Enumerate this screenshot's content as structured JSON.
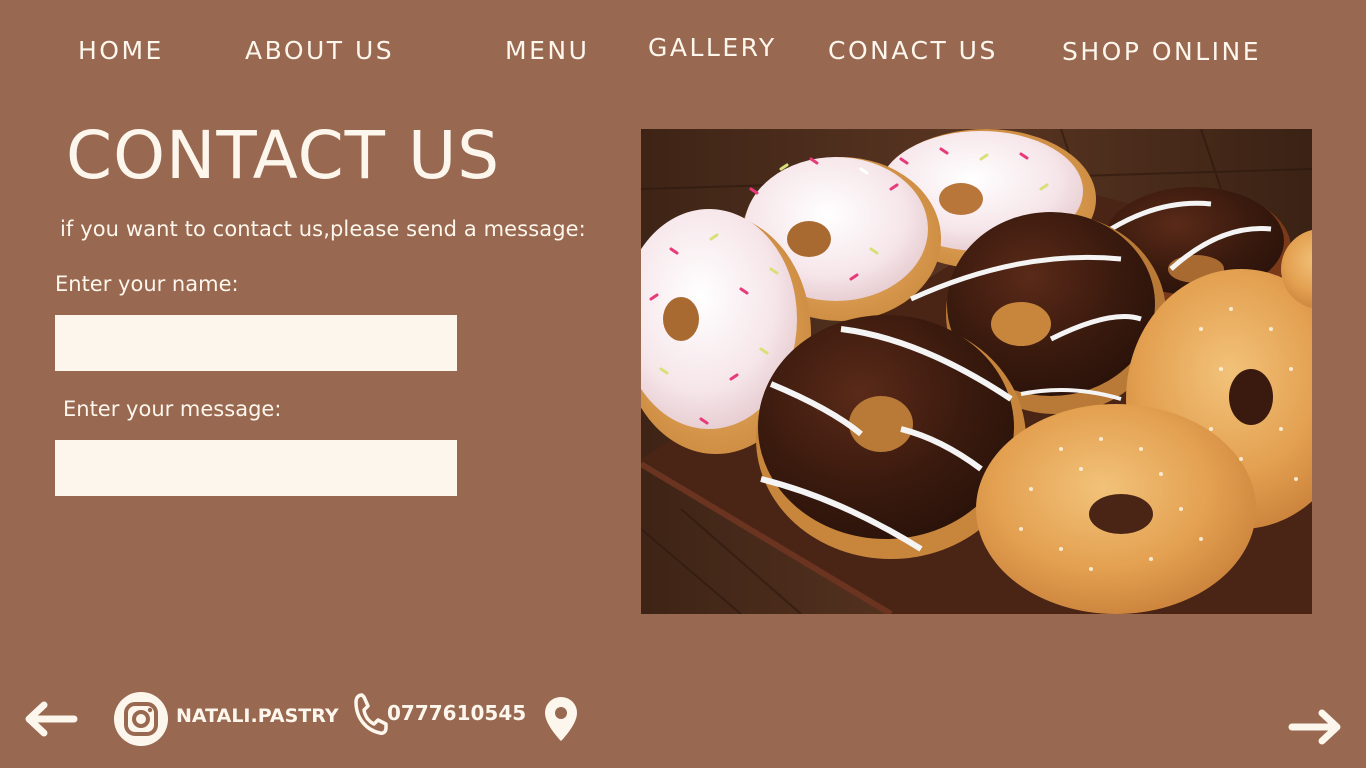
{
  "nav": {
    "home": "HOME",
    "about": "ABOUT US",
    "menu": "MENU",
    "gallery": "GALLERY",
    "contact": "CONACT US",
    "shop": "SHOP ONLINE"
  },
  "main": {
    "title": "CONTACT US",
    "subtitle": "if you want to contact us,please send a message:",
    "name_label": "Enter your name:",
    "name_value": "",
    "message_label": "Enter your message:",
    "message_value": ""
  },
  "footer": {
    "instagram_handle": "NATALI.PASTRY",
    "phone": "0777610545"
  },
  "icons": {
    "back": "arrow-left-icon",
    "instagram": "instagram-icon",
    "phone": "phone-icon",
    "location": "location-pin-icon",
    "forward": "arrow-right-icon"
  },
  "colors": {
    "background": "#986850",
    "text": "#fdf6ec",
    "input_bg": "#fdf6ec"
  }
}
